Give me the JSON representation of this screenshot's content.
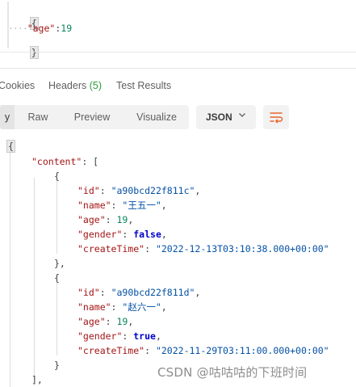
{
  "request_body": {
    "open_brace": "{",
    "key": "\"age\"",
    "colon": ":",
    "value": "19",
    "close_brace": "}"
  },
  "response_tabs": [
    {
      "label": "Cookies"
    },
    {
      "label": "Headers",
      "count": "(5)"
    },
    {
      "label": "Test Results"
    }
  ],
  "view_modes": {
    "pretty": "y",
    "raw": "Raw",
    "preview": "Preview",
    "visualize": "Visualize"
  },
  "format_select": {
    "value": "JSON"
  },
  "response_body": {
    "root_open": "{",
    "content_key": "\"content\"",
    "items": [
      {
        "id": "\"a90bcd22f811c\"",
        "name": "\"王五一\"",
        "age": "19",
        "gender": "false",
        "createTime": "\"2022-12-13T03:10:38.000+00:00\""
      },
      {
        "id": "\"a90bcd22f811d\"",
        "name": "\"赵六一\"",
        "age": "19",
        "gender": "true",
        "createTime": "\"2022-11-29T03:11:00.000+00:00\""
      }
    ],
    "keys": {
      "id": "\"id\"",
      "name": "\"name\"",
      "age": "\"age\"",
      "gender": "\"gender\"",
      "createTime": "\"createTime\""
    }
  },
  "watermark": "CSDN @咕咕咕的下班时间",
  "colors": {
    "key": "#a31515",
    "string": "#0451a5",
    "number": "#098658",
    "boolean": "#0000cc",
    "headers_count": "#2c9c3a",
    "wrap_icon": "#e8642c"
  }
}
